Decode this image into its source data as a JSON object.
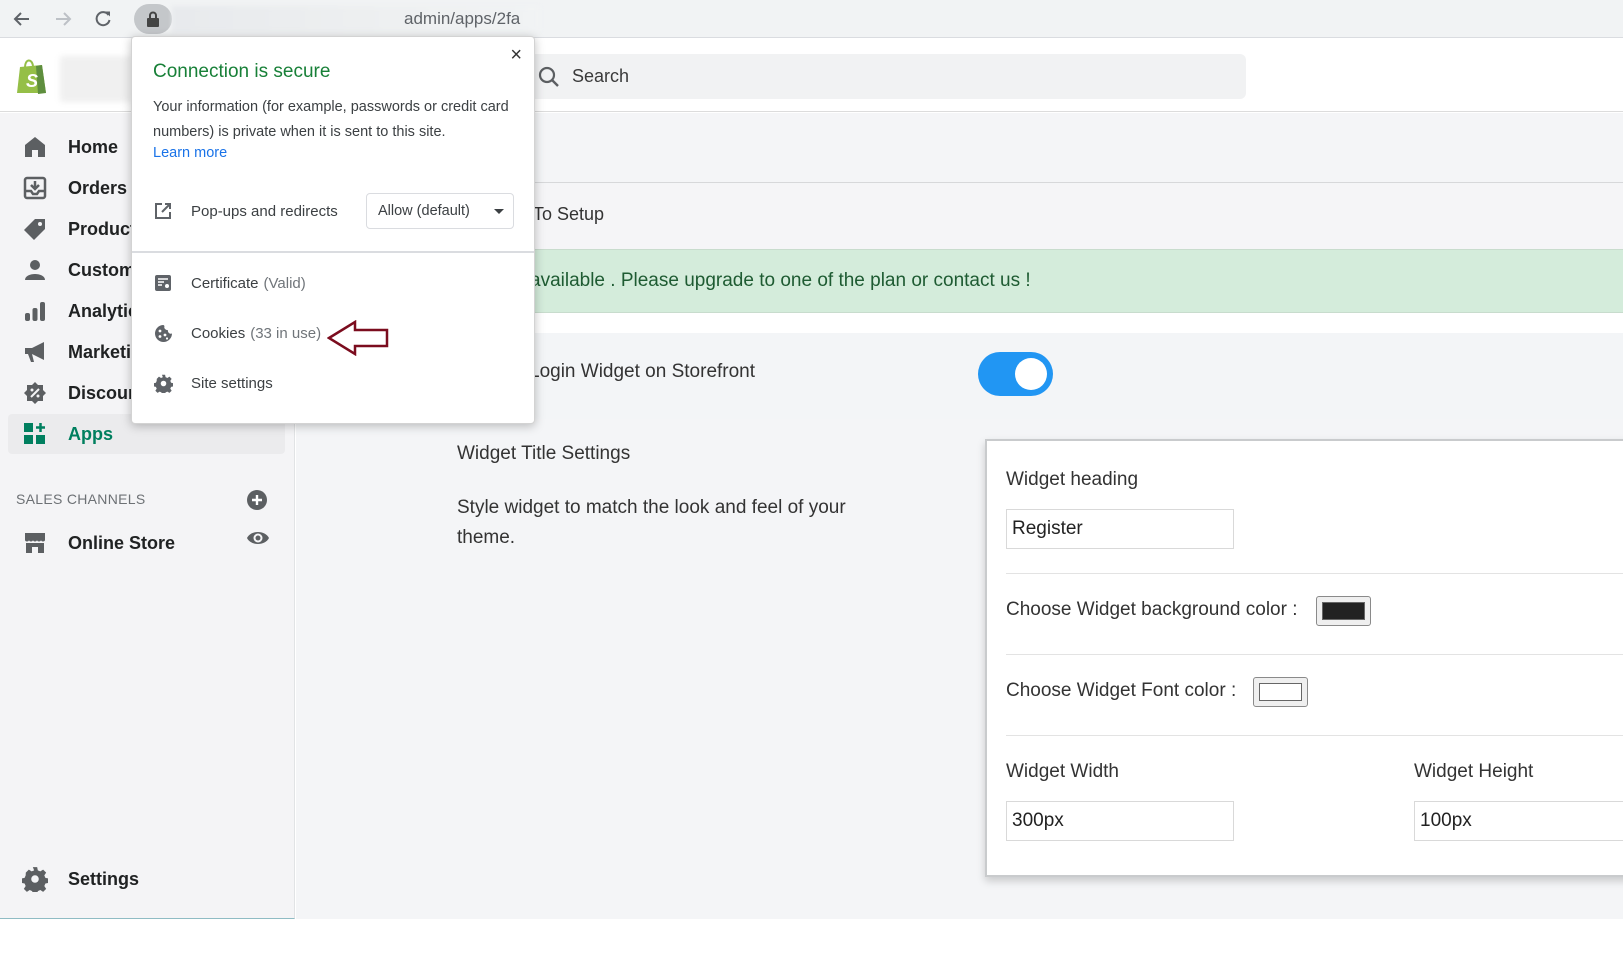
{
  "browser": {
    "url_visible": "admin/apps/2fa",
    "back_label": "Back",
    "forward_label": "Forward",
    "reload_label": "Reload"
  },
  "topbar": {
    "search_placeholder": "Search"
  },
  "sidebar": {
    "items": [
      {
        "label": "Home",
        "icon": "home-icon"
      },
      {
        "label": "Orders",
        "icon": "orders-icon"
      },
      {
        "label": "Products",
        "icon": "tag-icon"
      },
      {
        "label": "Customers",
        "icon": "person-icon"
      },
      {
        "label": "Analytics",
        "icon": "bar-chart-icon"
      },
      {
        "label": "Marketing",
        "icon": "megaphone-icon"
      },
      {
        "label": "Discounts",
        "icon": "discount-icon"
      },
      {
        "label": "Apps",
        "icon": "apps-icon",
        "active": true
      }
    ],
    "sales_channels_heading": "SALES CHANNELS",
    "online_store_label": "Online Store",
    "settings_label": "Settings"
  },
  "main": {
    "setup_text": "To Setup",
    "alert_text": "available . Please upgrade to one of the plan or contact us !",
    "toggle_label": "Login Widget on Storefront",
    "toggle_on": true,
    "section_title": "Widget Title Settings",
    "section_description": "Style widget to match the look and feel of your theme.",
    "card": {
      "heading_label": "Widget heading",
      "heading_value": "Register",
      "bg_color_label": "Choose Widget background color :",
      "bg_color_value": "#222222",
      "font_color_label": "Choose Widget Font color :",
      "font_color_value": "#ffffff",
      "width_label": "Widget Width",
      "width_value": "300px",
      "height_label": "Widget Height",
      "height_value": "100px"
    }
  },
  "popup": {
    "title": "Connection is secure",
    "body": "Your information (for example, passwords or credit card numbers) is private when it is sent to this site.",
    "learn_more": "Learn more",
    "popups_label": "Pop-ups and redirects",
    "popups_select_value": "Allow (default)",
    "certificate_label": "Certificate",
    "certificate_status": "(Valid)",
    "cookies_label": "Cookies",
    "cookies_status": "(33 in use)",
    "site_settings_label": "Site settings",
    "close_label": "×"
  },
  "colors": {
    "accent_green": "#007f5f",
    "secure_green": "#188038",
    "toggle_blue": "#2196f3",
    "alert_bg": "#d4ecdb",
    "annotation_arrow": "#7b0c1e"
  }
}
